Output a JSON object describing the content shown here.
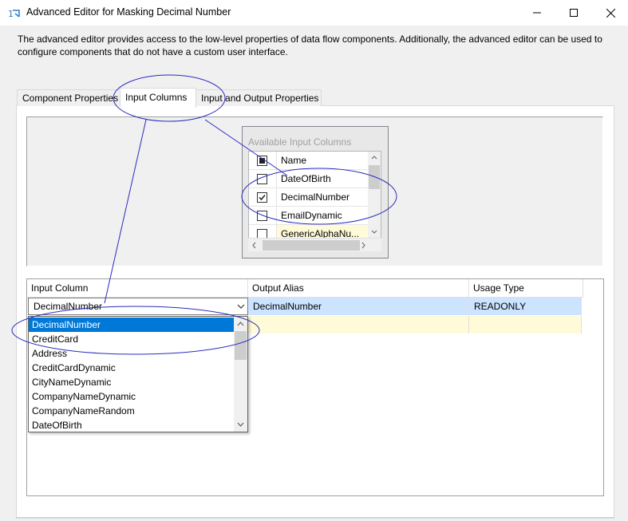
{
  "window": {
    "title": "Advanced Editor for Masking Decimal Number",
    "minimize_icon": "minimize-icon",
    "maximize_icon": "maximize-icon",
    "close_icon": "close-icon"
  },
  "description": "The advanced editor provides access to the low-level properties of data flow components. Additionally, the advanced editor can be used to configure components that do not have a custom user interface.",
  "tabs": [
    {
      "label": "Component Properties",
      "active": false
    },
    {
      "label": "Input Columns",
      "active": true
    },
    {
      "label": "Input and Output Properties",
      "active": false
    }
  ],
  "available_columns": {
    "title": "Available Input Columns",
    "header": "Name",
    "rows": [
      {
        "name": "DateOfBirth",
        "checked": false
      },
      {
        "name": "DecimalNumber",
        "checked": true
      },
      {
        "name": "EmailDynamic",
        "checked": false
      },
      {
        "name": "GenericAlphaNu...",
        "checked": false
      }
    ]
  },
  "grid": {
    "columns": [
      "Input Column",
      "Output Alias",
      "Usage Type"
    ],
    "rows": [
      {
        "input_column": "DecimalNumber",
        "output_alias": "DecimalNumber",
        "usage_type": "READONLY"
      }
    ]
  },
  "dropdown": {
    "selected": "DecimalNumber",
    "items": [
      "DecimalNumber",
      "CreditCard",
      "Address",
      "CreditCardDynamic",
      "CityNameDynamic",
      "CompanyNameDynamic",
      "CompanyNameRandom",
      "DateOfBirth"
    ]
  },
  "colors": {
    "selection": "#0078d7",
    "row_highlight": "#cce4ff",
    "new_row": "#fffbd8",
    "annotation": "#2b2bbf"
  }
}
